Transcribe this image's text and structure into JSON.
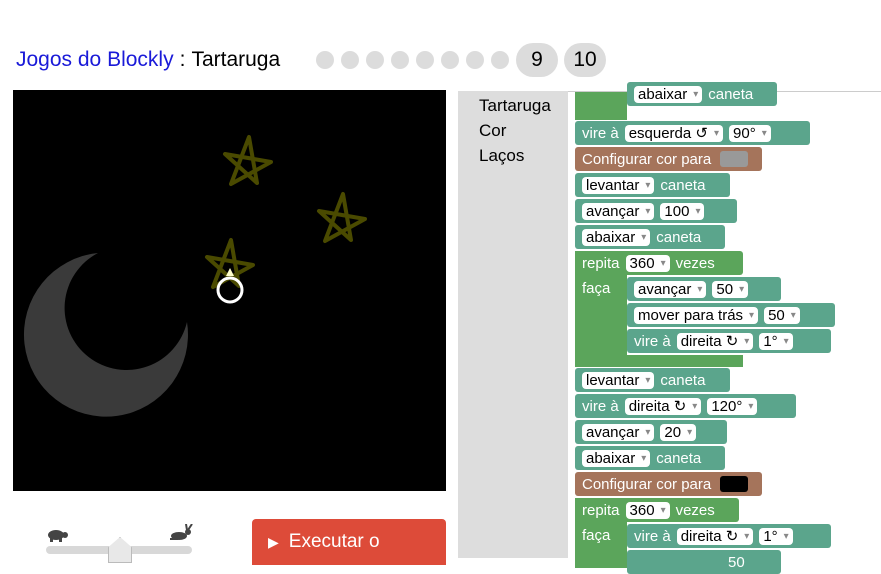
{
  "header": {
    "link": "Jogos do Blockly",
    "sep": ":",
    "title": "Tartaruga",
    "levels": [
      "9",
      "10"
    ]
  },
  "toolbox": {
    "categories": [
      "Tartaruga",
      "Cor",
      "Laços"
    ]
  },
  "run_button": {
    "label": "Executar o"
  },
  "blocks": {
    "b0": [
      "abaixar",
      "caneta"
    ],
    "b1": [
      "vire à",
      "esquerda ↺",
      "90°"
    ],
    "b2": [
      "Configurar cor para"
    ],
    "b3": [
      "levantar",
      "caneta"
    ],
    "b4": [
      "avançar",
      "100"
    ],
    "b5": [
      "abaixar",
      "caneta"
    ],
    "b6": [
      "repita",
      "360",
      "vezes"
    ],
    "b6_faca": "faça",
    "b7": [
      "avançar",
      "50"
    ],
    "b8": [
      "mover para trás",
      "50"
    ],
    "b9": [
      "vire à",
      "direita ↻",
      "1°"
    ],
    "b10": [
      "levantar",
      "caneta"
    ],
    "b11": [
      "vire à",
      "direita ↻",
      "120°"
    ],
    "b12": [
      "avançar",
      "20"
    ],
    "b13": [
      "abaixar",
      "caneta"
    ],
    "b14": [
      "Configurar cor para"
    ],
    "b15": [
      "repita",
      "360",
      "vezes"
    ],
    "b15_faca": "faça",
    "b16": [
      "vire à",
      "direita ↻",
      "1°"
    ],
    "b17": [
      "50"
    ]
  },
  "colors": {
    "swatch1": "#999999",
    "swatch2": "#000000",
    "star": "#4a4a00",
    "moon": "#3a3a3a"
  }
}
